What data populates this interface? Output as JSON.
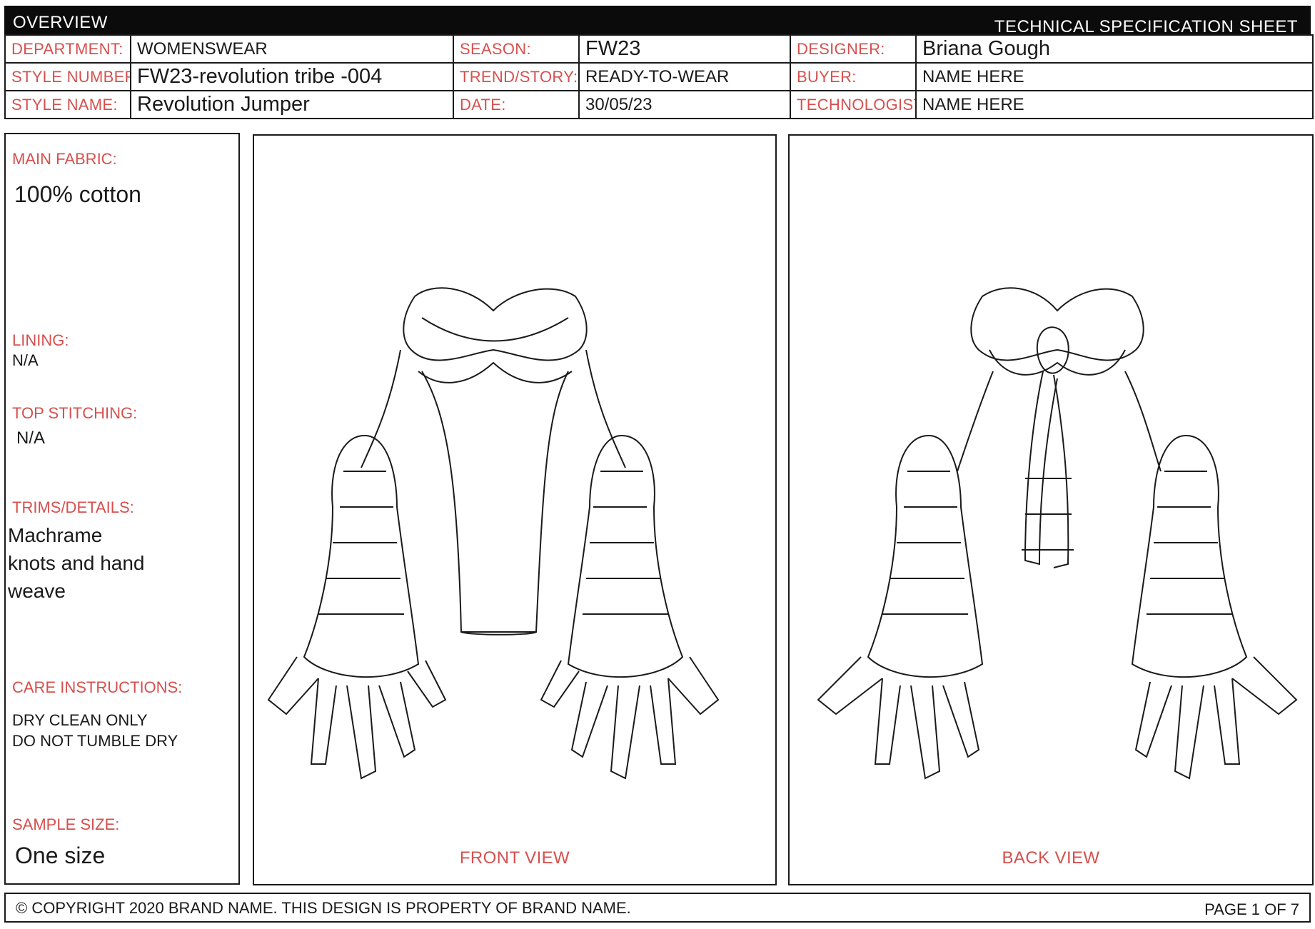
{
  "header": {
    "overview": "OVERVIEW",
    "sheet_title": "TECHNICAL SPECIFICATION SHEET"
  },
  "fields": {
    "department_label": "DEPARTMENT:",
    "department": "WOMENSWEAR",
    "style_number_label": "STYLE NUMBER:",
    "style_number": "FW23-revolution tribe -004",
    "style_name_label": "STYLE NAME:",
    "style_name": "Revolution Jumper",
    "season_label": "SEASON:",
    "season": "FW23",
    "trend_label": "TREND/STORY:",
    "trend": "READY-TO-WEAR",
    "date_label": "DATE:",
    "date": "30/05/23",
    "designer_label": "DESIGNER:",
    "designer": "Briana Gough",
    "buyer_label": "BUYER:",
    "buyer": "NAME HERE",
    "technologist_label": "TECHNOLOGIST:",
    "technologist": "NAME HERE"
  },
  "details": {
    "main_fabric_label": "MAIN FABRIC:",
    "main_fabric": "100% cotton",
    "lining_label": "LINING:",
    "lining": "N/A",
    "top_stitching_label": "TOP STITCHING:",
    "top_stitching": "N/A",
    "trims_label": "TRIMS/DETAILS:",
    "trims_line1": "Machrame",
    "trims_line2": "knots and hand",
    "trims_line3": "weave",
    "care_label": "CARE INSTRUCTIONS:",
    "care_line1": "DRY CLEAN ONLY",
    "care_line2": "DO NOT TUMBLE DRY",
    "sample_size_label": "SAMPLE SIZE:",
    "sample_size": "One size"
  },
  "views": {
    "front": "FRONT VIEW",
    "back": "BACK VIEW"
  },
  "footer": {
    "copyright": "© COPYRIGHT 2020 BRAND NAME. THIS DESIGN IS PROPERTY OF BRAND NAME.",
    "page": "PAGE 1 OF 7"
  },
  "colors": {
    "label_red": "#d6504e",
    "bar_black": "#0b0b0b"
  }
}
